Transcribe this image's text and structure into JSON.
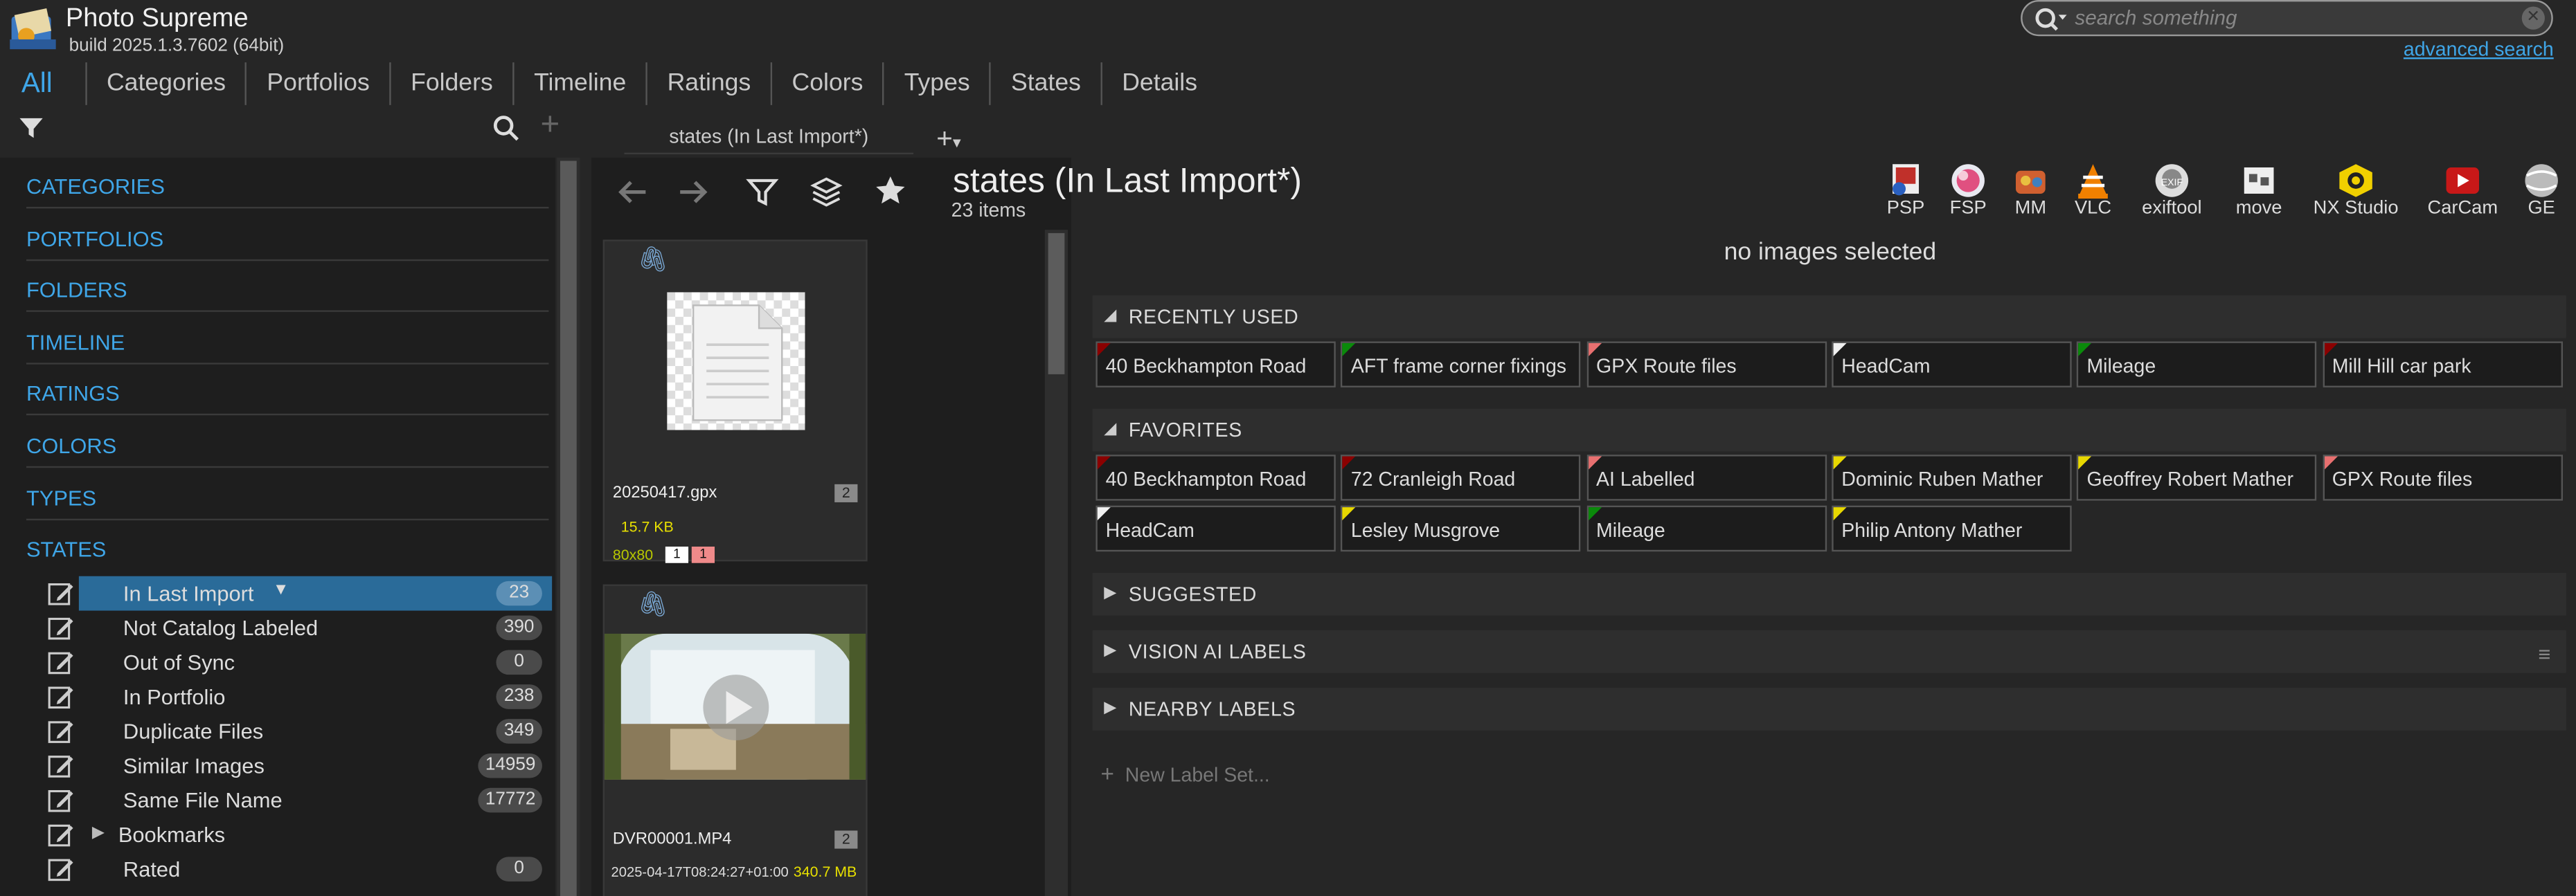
{
  "app": {
    "title": "Photo Supreme",
    "build": "build 2025.1.3.7602 (64bit)"
  },
  "search": {
    "placeholder": "search something",
    "advanced": "advanced search"
  },
  "nav": {
    "tabs": [
      "All",
      "Categories",
      "Portfolios",
      "Folders",
      "Timeline",
      "Ratings",
      "Colors",
      "Types",
      "States",
      "Details"
    ]
  },
  "left": {
    "sections": [
      "CATEGORIES",
      "PORTFOLIOS",
      "FOLDERS",
      "TIMELINE",
      "RATINGS",
      "COLORS",
      "TYPES",
      "STATES"
    ],
    "items": [
      {
        "label": "In Last Import",
        "count": "23",
        "selected": true
      },
      {
        "label": "Not Catalog Labeled",
        "count": "390"
      },
      {
        "label": "Out of Sync",
        "count": "0"
      },
      {
        "label": "In Portfolio",
        "count": "238"
      },
      {
        "label": "Duplicate Files",
        "count": "349"
      },
      {
        "label": "Similar Images",
        "count": "14959"
      },
      {
        "label": "Same File Name",
        "count": "17772"
      },
      {
        "label": "Bookmarks",
        "count": ""
      },
      {
        "label": "Rated",
        "count": "0"
      }
    ]
  },
  "middle": {
    "tab": "states (In Last Import*)",
    "cards": [
      {
        "name": "20250417.gpx",
        "badge": "2",
        "size": "15.7 KB",
        "dims": "80x80",
        "tags": [
          "1",
          "1"
        ]
      },
      {
        "name": "DVR00001.MP4",
        "badge": "2",
        "date": "2025-04-17T08:24:27+01:00",
        "size": "340.7 MB"
      }
    ]
  },
  "main": {
    "title": "states (In Last Import*)",
    "count": "23 items",
    "no_selection": "no images selected",
    "apps": [
      {
        "label": "PSP",
        "icon": "psp-icon"
      },
      {
        "label": "FSP",
        "icon": "fsp-icon"
      },
      {
        "label": "MM",
        "icon": "mm-icon"
      },
      {
        "label": "VLC",
        "icon": "vlc-icon"
      },
      {
        "label": "exiftool",
        "icon": "exiftool-icon"
      },
      {
        "label": "move",
        "icon": "move-icon"
      },
      {
        "label": "NX Studio",
        "icon": "nx-studio-icon"
      },
      {
        "label": "CarCam",
        "icon": "carcam-icon"
      },
      {
        "label": "GE",
        "icon": "ge-icon"
      }
    ],
    "label_sections": {
      "recent": {
        "title": "RECENTLY USED",
        "labels": [
          {
            "text": "40 Beckhampton Road",
            "flag": "#8b0000"
          },
          {
            "text": "AFT frame corner fixings",
            "flag": "#0a8a0a"
          },
          {
            "text": "GPX Route files",
            "flag": "#e87070"
          },
          {
            "text": "HeadCam",
            "flag": "#f0f0f0"
          },
          {
            "text": "Mileage",
            "flag": "#0a8a0a"
          },
          {
            "text": "Mill Hill car park",
            "flag": "#8b0000"
          }
        ]
      },
      "favorites": {
        "title": "FAVORITES",
        "labels": [
          {
            "text": "40 Beckhampton Road",
            "flag": "#8b0000"
          },
          {
            "text": "72 Cranleigh Road",
            "flag": "#8b0000"
          },
          {
            "text": "AI Labelled",
            "flag": "#e87070"
          },
          {
            "text": "Dominic Ruben Mather",
            "flag": "#e8d800"
          },
          {
            "text": "Geoffrey Robert Mather",
            "flag": "#e8d800"
          },
          {
            "text": "GPX Route files",
            "flag": "#e87070"
          },
          {
            "text": "HeadCam",
            "flag": "#f0f0f0"
          },
          {
            "text": "Lesley Musgrove",
            "flag": "#e8d800"
          },
          {
            "text": "Mileage",
            "flag": "#0a8a0a"
          },
          {
            "text": "Philip Antony Mather",
            "flag": "#e8d800"
          }
        ]
      },
      "suggested": {
        "title": "SUGGESTED"
      },
      "vision": {
        "title": "VISION AI LABELS"
      },
      "nearby": {
        "title": "NEARBY LABELS"
      }
    },
    "new_label_set": "New Label Set..."
  }
}
